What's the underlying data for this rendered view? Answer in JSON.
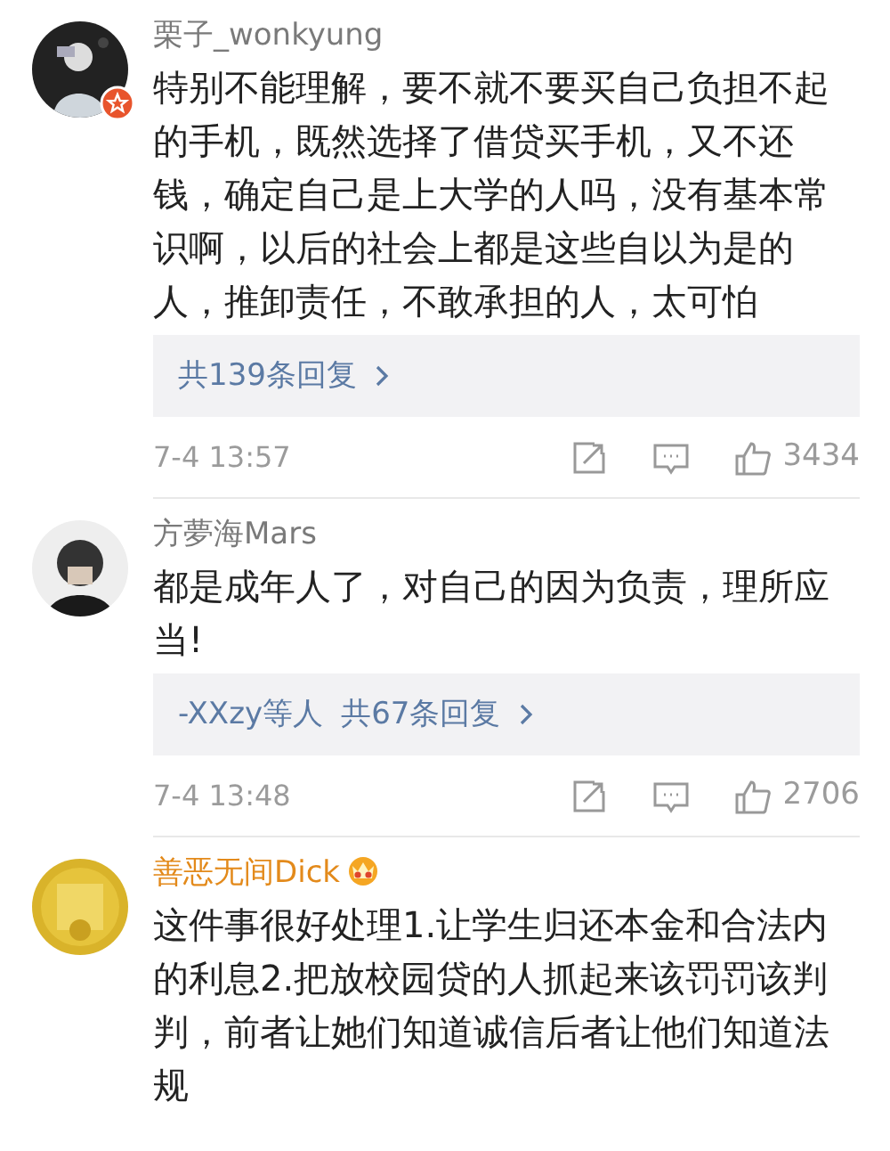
{
  "comments": [
    {
      "username": "栗子_wonkyung",
      "verified": true,
      "member": false,
      "text": "特别不能理解，要不就不要买自己负担不起的手机，既然选择了借贷买手机，又不还钱，确定自己是上大学的人吗，没有基本常识啊，以后的社会上都是这些自以为是的人，推卸责任，不敢承担的人，太可怕",
      "replies": {
        "count": "共139条回复"
      },
      "time": "7-4 13:57",
      "likes": "3434"
    },
    {
      "username": "方夢海Mars",
      "verified": false,
      "member": false,
      "text": "都是成年人了，对自己的因为负责，理所应当!",
      "replies": {
        "repliers": "-XXzy等人",
        "count": "共67条回复"
      },
      "time": "7-4 13:48",
      "likes": "2706"
    },
    {
      "username": "善恶无间Dick",
      "verified": false,
      "member": true,
      "text": "这件事很好处理1.让学生归还本金和合法内的利息2.把放校园贷的人抓起来该罚罚该判判，前者让她们知道诚信后者让他们知道法规"
    }
  ]
}
